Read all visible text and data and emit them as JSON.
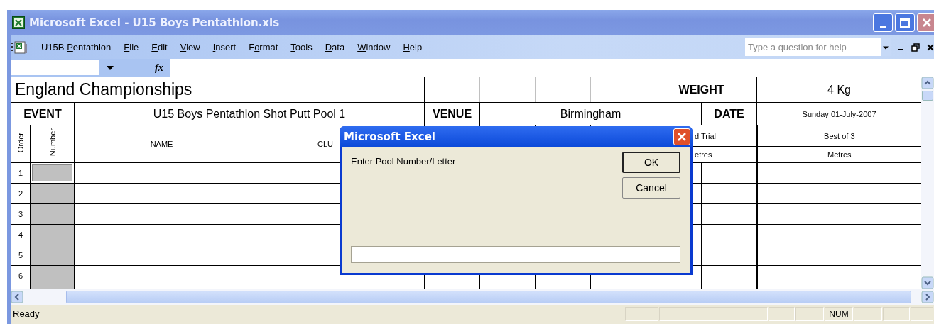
{
  "window": {
    "title": "Microsoft Excel - U15 Boys Pentathlon.xls"
  },
  "menu": {
    "workbook": "U15B Pentathlon",
    "items": [
      {
        "label": "File"
      },
      {
        "label": "Edit"
      },
      {
        "label": "View"
      },
      {
        "label": "Insert"
      },
      {
        "label": "Format"
      },
      {
        "label": "Tools"
      },
      {
        "label": "Data"
      },
      {
        "label": "Window"
      },
      {
        "label": "Help"
      }
    ]
  },
  "help_search": {
    "placeholder": "Type a question for help"
  },
  "formula_bar": {
    "function_label": "fx"
  },
  "sheet": {
    "title": "England Championships",
    "weight_label": "WEIGHT",
    "weight": "4 Kg",
    "event_label": "EVENT",
    "event": "U15 Boys Pentathlon Shot Putt Pool 1",
    "venue_label": "VENUE",
    "venue": "Birmingham",
    "date_label": "DATE",
    "date": "Sunday 01-July-2007",
    "headers": {
      "order": "Order",
      "number": "Number",
      "name": "NAME",
      "club": "CLU",
      "trial": "d Trial",
      "trial_unit": "etres",
      "best": "Best of 3",
      "best_unit": "Metres"
    },
    "rows": [
      {
        "order": "1",
        "selected": true
      },
      {
        "order": "2",
        "selected": false
      },
      {
        "order": "3",
        "selected": false
      },
      {
        "order": "4",
        "selected": false
      },
      {
        "order": "5",
        "selected": false
      },
      {
        "order": "6",
        "selected": false
      }
    ]
  },
  "dialog": {
    "title": "Microsoft Excel",
    "prompt": "Enter Pool Number/Letter",
    "buttons": [
      {
        "label": "OK",
        "default": true
      },
      {
        "label": "Cancel",
        "default": false
      }
    ]
  },
  "status_bar": {
    "text": "Ready",
    "indicators": [
      "NUM"
    ]
  }
}
